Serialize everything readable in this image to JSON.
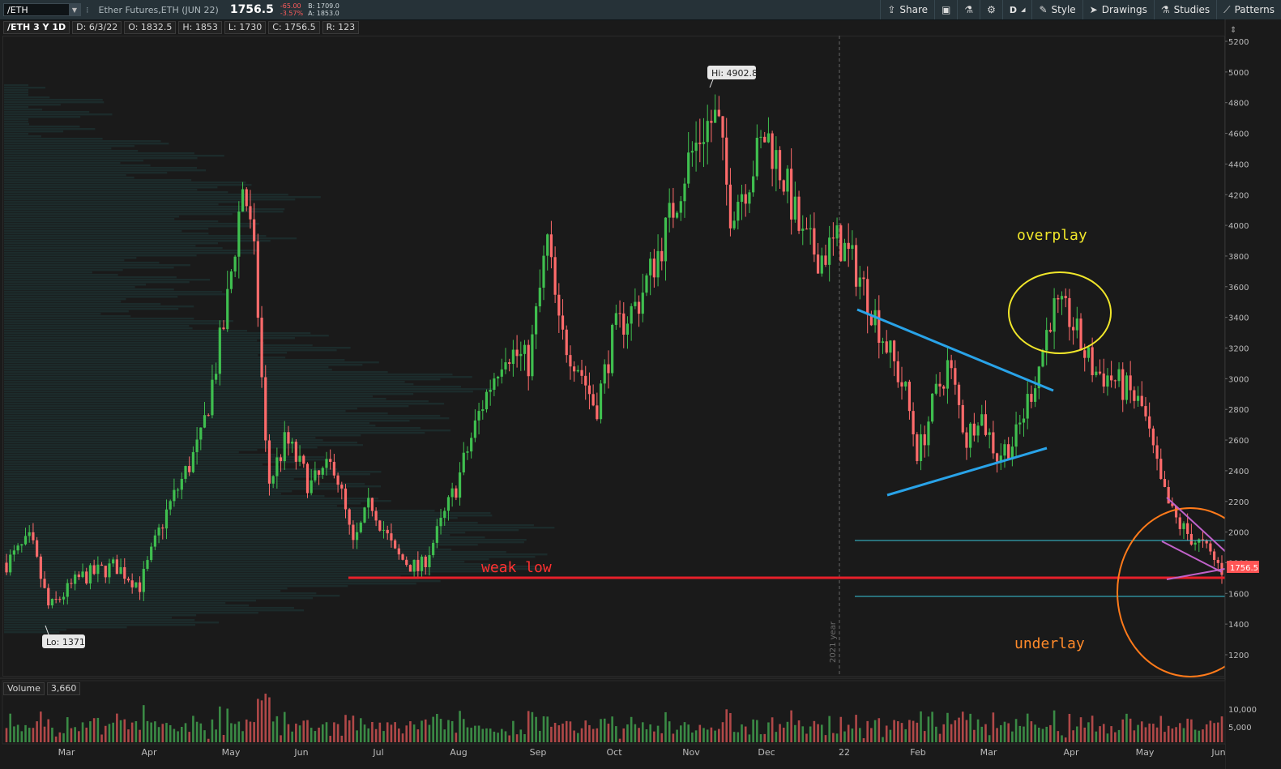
{
  "toolbar": {
    "symbol": "/ETH",
    "description": "Ether Futures,ETH (JUN 22)",
    "last": "1756.5",
    "change": "-65.00",
    "change_pct": "-3.57%",
    "bid": "B: 1709.0",
    "ask": "A: 1853.0",
    "buttons": [
      {
        "label": "Share",
        "icon": "share-icon"
      },
      {
        "label": "",
        "icon": "snapshot-icon"
      },
      {
        "label": "",
        "icon": "flask-icon"
      },
      {
        "label": "",
        "icon": "gear-icon"
      },
      {
        "label": "D",
        "icon": ""
      },
      {
        "label": "Style",
        "icon": "style-icon"
      },
      {
        "label": "Drawings",
        "icon": "cursor-icon"
      },
      {
        "label": "Studies",
        "icon": "flask-icon"
      },
      {
        "label": "Patterns",
        "icon": "pattern-icon"
      }
    ]
  },
  "infobar": {
    "title": "/ETH 3 Y 1D",
    "date": "D: 6/3/22",
    "open": "O: 1832.5",
    "high": "H: 1853",
    "low": "L: 1730",
    "close": "C: 1756.5",
    "range": "R: 123"
  },
  "volume_pane": {
    "label": "Volume",
    "value": "3,660"
  },
  "colors": {
    "up": "#3fbf4f",
    "down": "#ff6b6b",
    "trendline": "#29a3e8",
    "support": "#e8202a",
    "circle_top": "#f0e62a",
    "circle_bottom": "#ff7a1a",
    "wedge": "#c062c9",
    "level": "#38c6d9"
  },
  "annotations": {
    "hi": "Hi: 4902.8",
    "lo": "Lo: 1371",
    "weak_low": "weak low",
    "overplay": "overplay",
    "underlay": "underlay",
    "year_marker": "2021 year",
    "price_tag": "1756.5"
  },
  "chart_data": {
    "type": "candlestick",
    "ylim": [
      1100,
      5250
    ],
    "y_ticks": [
      1200,
      1400,
      1600,
      1800,
      2000,
      2200,
      2400,
      2600,
      2800,
      3000,
      3200,
      3400,
      3600,
      3800,
      4000,
      4200,
      4400,
      4600,
      4800,
      5000,
      5200
    ],
    "y_tick_labels": [
      "1200",
      "1400",
      "1600",
      "1800",
      "2000",
      "2200",
      "2400",
      "2600",
      "2800",
      "3000",
      "3200",
      "3400",
      "3600",
      "3800",
      "4000",
      "4200",
      "4400",
      "4600",
      "4800",
      "5000",
      "5200"
    ],
    "x_labels": [
      "Mar",
      "Apr",
      "May",
      "Jun",
      "Jul",
      "Aug",
      "Sep",
      "Oct",
      "Nov",
      "Dec",
      "22",
      "Feb",
      "Mar",
      "Apr",
      "May",
      "Jun"
    ],
    "volume_ticks": [
      "10,000",
      "5,000"
    ],
    "price_path": [
      [
        0,
        1800
      ],
      [
        0.02,
        1950
      ],
      [
        0.035,
        1500
      ],
      [
        0.06,
        1700
      ],
      [
        0.09,
        1780
      ],
      [
        0.11,
        1650
      ],
      [
        0.13,
        2100
      ],
      [
        0.16,
        2600
      ],
      [
        0.18,
        3400
      ],
      [
        0.195,
        4300
      ],
      [
        0.205,
        3700
      ],
      [
        0.215,
        2300
      ],
      [
        0.23,
        2600
      ],
      [
        0.25,
        2300
      ],
      [
        0.27,
        2450
      ],
      [
        0.285,
        1900
      ],
      [
        0.3,
        2200
      ],
      [
        0.32,
        1850
      ],
      [
        0.34,
        1750
      ],
      [
        0.355,
        2000
      ],
      [
        0.37,
        2300
      ],
      [
        0.39,
        2800
      ],
      [
        0.41,
        3200
      ],
      [
        0.43,
        3100
      ],
      [
        0.445,
        3900
      ],
      [
        0.455,
        3300
      ],
      [
        0.47,
        3100
      ],
      [
        0.485,
        2800
      ],
      [
        0.5,
        3300
      ],
      [
        0.52,
        3500
      ],
      [
        0.54,
        3900
      ],
      [
        0.56,
        4400
      ],
      [
        0.575,
        4650
      ],
      [
        0.585,
        4700
      ],
      [
        0.595,
        4100
      ],
      [
        0.61,
        4300
      ],
      [
        0.625,
        4600
      ],
      [
        0.64,
        4300
      ],
      [
        0.655,
        3900
      ],
      [
        0.67,
        3800
      ],
      [
        0.685,
        3900
      ],
      [
        0.7,
        3700
      ],
      [
        0.72,
        3300
      ],
      [
        0.74,
        2900
      ],
      [
        0.75,
        2500
      ],
      [
        0.765,
        2900
      ],
      [
        0.775,
        3100
      ],
      [
        0.79,
        2600
      ],
      [
        0.8,
        2800
      ],
      [
        0.815,
        2500
      ],
      [
        0.83,
        2600
      ],
      [
        0.85,
        3100
      ],
      [
        0.86,
        3450
      ],
      [
        0.875,
        3400
      ],
      [
        0.885,
        3200
      ],
      [
        0.895,
        3050
      ],
      [
        0.91,
        3000
      ],
      [
        0.925,
        2900
      ],
      [
        0.935,
        2800
      ],
      [
        0.95,
        2300
      ],
      [
        0.96,
        2100
      ],
      [
        0.97,
        2000
      ],
      [
        0.985,
        1900
      ],
      [
        1.0,
        1756.5
      ]
    ]
  }
}
